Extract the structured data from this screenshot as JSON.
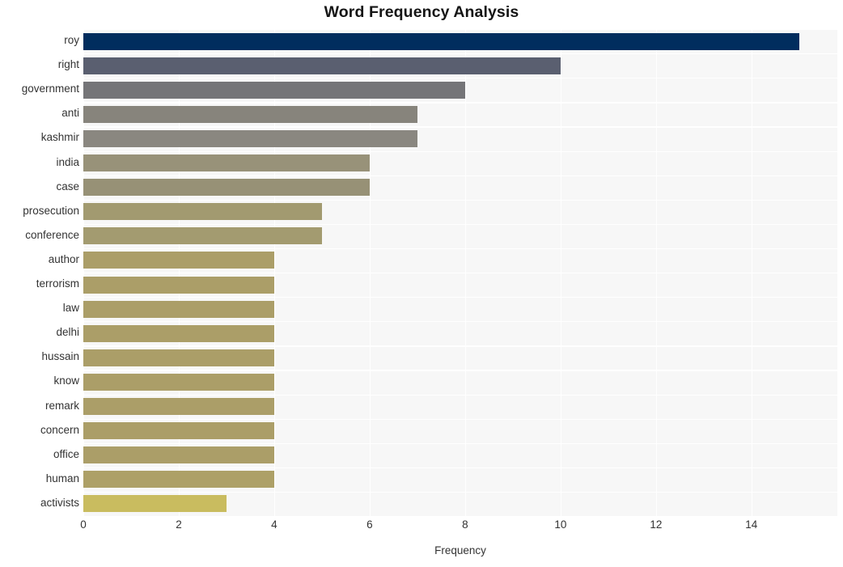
{
  "chart_data": {
    "type": "bar",
    "orientation": "horizontal",
    "title": "Word Frequency Analysis",
    "xlabel": "Frequency",
    "ylabel": "",
    "xlim": [
      0,
      15.8
    ],
    "ylim": [
      0,
      20
    ],
    "grid": true,
    "legend": false,
    "xticks": [
      "0",
      "2",
      "4",
      "6",
      "8",
      "10",
      "12",
      "14"
    ],
    "xtick_values": [
      0,
      2,
      4,
      6,
      8,
      10,
      12,
      14
    ],
    "categories": [
      "roy",
      "right",
      "government",
      "anti",
      "kashmir",
      "india",
      "case",
      "prosecution",
      "conference",
      "author",
      "terrorism",
      "law",
      "delhi",
      "hussain",
      "know",
      "remark",
      "concern",
      "office",
      "human",
      "activists"
    ],
    "values": [
      15,
      10,
      8,
      7,
      7,
      6,
      6,
      5,
      5,
      4,
      4,
      4,
      4,
      4,
      4,
      4,
      4,
      4,
      4,
      3
    ],
    "bar_colors": [
      "#012d5e",
      "#5a5f70",
      "#757578",
      "#87847c",
      "#8a8780",
      "#989279",
      "#979176",
      "#a29a70",
      "#a39b70",
      "#ab9e68",
      "#ab9e68",
      "#ab9e68",
      "#ab9e68",
      "#ab9e68",
      "#ab9e68",
      "#ab9e68",
      "#ab9e68",
      "#ab9e68",
      "#ada067",
      "#c9bc5f"
    ],
    "plot_background": "#f7f7f7",
    "grid_color": "#ffffff",
    "figure_background": "#ffffff",
    "tick_label_color": "#333333",
    "title_color": "#151515"
  }
}
